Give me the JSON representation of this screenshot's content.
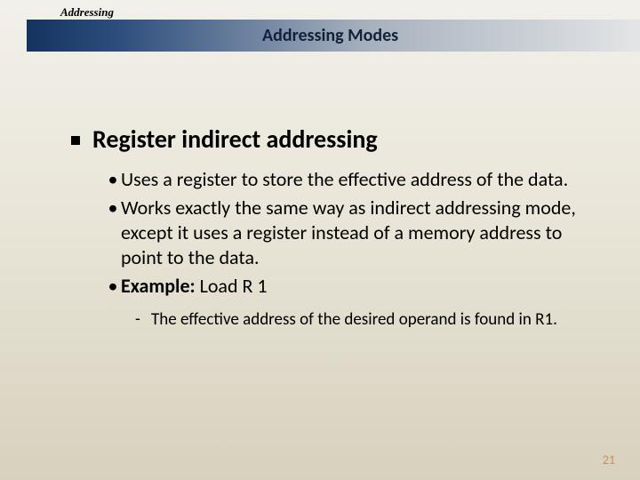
{
  "header": {
    "topLabel": "Addressing",
    "title": "Addressing Modes"
  },
  "main": {
    "heading": "Register indirect addressing",
    "bullets": [
      "Uses a register to store the effective address of the data.",
      "Works exactly the same way as indirect addressing mode, except it uses a register instead of a memory address to point to the data."
    ],
    "example": {
      "label": "Example:",
      "text": " Load R 1"
    },
    "subnote": "The effective address of the desired operand is found in R1."
  },
  "footer": {
    "pageNumber": "21"
  }
}
